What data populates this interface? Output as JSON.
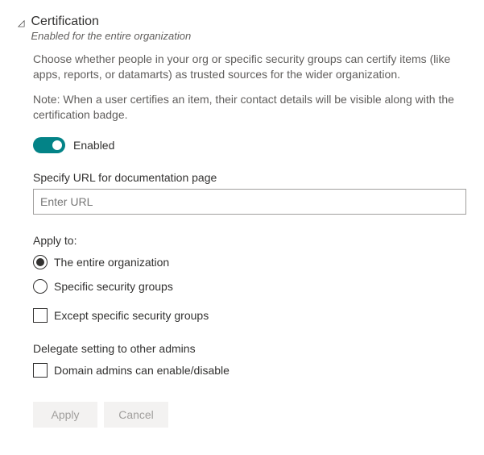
{
  "header": {
    "title": "Certification",
    "subtitle": "Enabled for the entire organization"
  },
  "description": "Choose whether people in your org or specific security groups can certify items (like apps, reports, or datamarts) as trusted sources for the wider organization.",
  "note": "Note: When a user certifies an item, their contact details will be visible along with the certification badge.",
  "toggle": {
    "label": "Enabled"
  },
  "url_field": {
    "label": "Specify URL for documentation page",
    "placeholder": "Enter URL"
  },
  "apply_to": {
    "label": "Apply to:",
    "options": [
      {
        "label": "The entire organization"
      },
      {
        "label": "Specific security groups"
      }
    ],
    "except_label": "Except specific security groups"
  },
  "delegate": {
    "label": "Delegate setting to other admins",
    "option_label": "Domain admins can enable/disable"
  },
  "buttons": {
    "apply": "Apply",
    "cancel": "Cancel"
  }
}
